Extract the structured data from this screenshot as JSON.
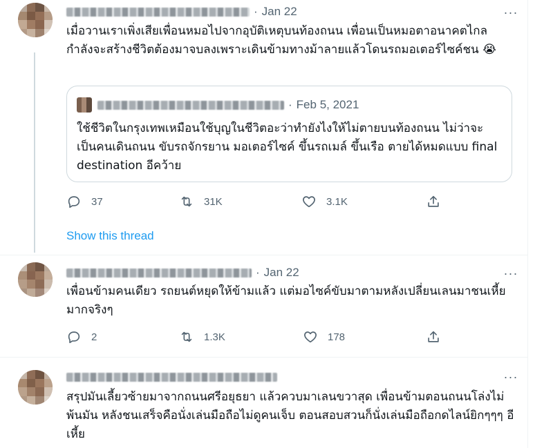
{
  "tweets": [
    {
      "date": "Jan 22",
      "text": "เมื่อวานเราเพิ่งเสียเพื่อนหมอไปจากอุบัติเหตุบนท้องถนน เพื่อนเป็นหมอตาอนาคตไกล กำลังจะสร้างชีวิตต้องมาจบลงเพราะเดินข้ามทางม้าลายแล้วโดนรถมอเตอร์ไซค์ชน 😭",
      "quote": {
        "date": "Feb 5, 2021",
        "text": "ใช้ชีวิตในกรุงเทพเหมือนใช้บุญในชีวิตอะว่าทำยังไงให้ไม่ตายบนท้องถนน ไม่ว่าจะเป็นคนเดินถนน ขับรถจักรยาน มอเตอร์ไซค์ ขึ้นรถเมล์ ขึ้นเรือ ตายได้หมดแบบ final destination อีคว้าย"
      },
      "replies": "37",
      "retweets": "31K",
      "likes": "3.1K",
      "show_thread": "Show this thread"
    },
    {
      "date": "Jan 22",
      "text": "เพื่อนข้ามคนเดียว รถยนต์หยุดให้ข้ามแล้ว แต่มอไซค์ขับมาตามหลังเปลี่ยนเลนมาชนเหี้ยมากจริงๆ",
      "replies": "2",
      "retweets": "1.3K",
      "likes": "178"
    },
    {
      "text": "สรุปมันเลี้ยวซ้ายมาจากถนนศรีอยุธยา แล้วควบมาเลนขวาสุด เพื่อนข้ามตอนถนนโล่งไม่พ้นมัน  หลังชนเสร็จคือนั่งเล่นมือถือไม่ดูคนเจ็บ ตอนสอบสวนก็นั่งเล่นมือถือกดไลน์ยิกๆๆๆ อีเหี้ย"
    }
  ],
  "icons": {
    "reply": "reply-icon",
    "retweet": "retweet-icon",
    "like": "heart-icon",
    "share": "share-icon",
    "more": "more-icon"
  },
  "colors": {
    "link": "#1d9bf0",
    "secondary_text": "#536471",
    "border": "#cfd9de"
  }
}
